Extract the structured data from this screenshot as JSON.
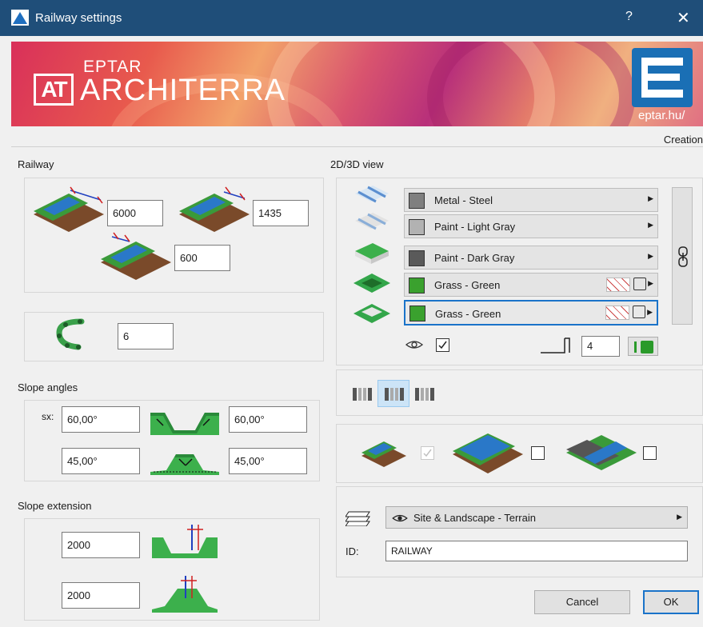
{
  "window": {
    "title": "Railway settings",
    "help": "?",
    "close": "✕"
  },
  "banner": {
    "brand_top": "EPTAR",
    "brand_main": "ARCHITERRA",
    "logo_letters": "AT",
    "url": "eptar.hu/"
  },
  "creation_label": "Creation",
  "railway": {
    "label": "Railway",
    "spacing": "6000",
    "gauge": "1435",
    "sleeper": "600",
    "segments": "6"
  },
  "slope_angles": {
    "label": "Slope angles",
    "prefix": "sx:",
    "cut_left": "60,00°",
    "cut_right": "60,00°",
    "fill_left": "45,00°",
    "fill_right": "45,00°"
  },
  "slope_extension": {
    "label": "Slope extension",
    "cut": "2000",
    "fill": "2000"
  },
  "view": {
    "label": "2D/3D view",
    "materials": [
      {
        "name": "Metal - Steel",
        "color": "#7f7f7f"
      },
      {
        "name": "Paint - Light Gray",
        "color": "#b2b2b2"
      },
      {
        "name": "Paint - Dark Gray",
        "color": "#5a5a5a"
      },
      {
        "name": "Grass - Green",
        "color": "#3aa12e"
      },
      {
        "name": "Grass - Green",
        "color": "#3aa12e"
      }
    ],
    "pen_value": "4",
    "visible_checked": true
  },
  "layer": {
    "name": "Site & Landscape - Terrain",
    "id_label": "ID:",
    "id_value": "RAILWAY"
  },
  "buttons": {
    "cancel": "Cancel",
    "ok": "OK"
  }
}
